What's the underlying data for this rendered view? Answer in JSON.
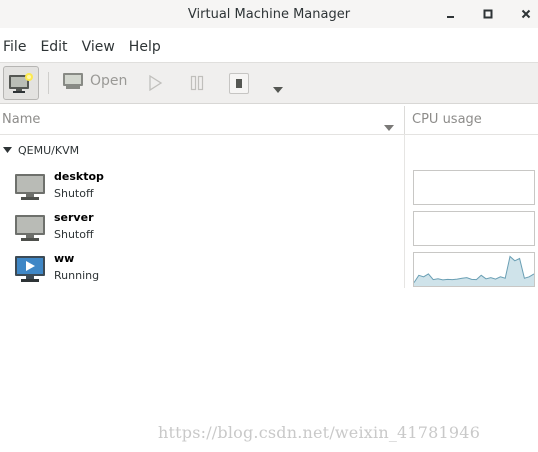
{
  "window": {
    "title": "Virtual Machine Manager"
  },
  "menu": [
    "File",
    "Edit",
    "View",
    "Help"
  ],
  "toolbar": {
    "open_label": "Open"
  },
  "columns": {
    "name": "Name",
    "cpu": "CPU usage"
  },
  "group": {
    "label": "QEMU/KVM"
  },
  "vms": [
    {
      "name": "desktop",
      "status": "Shutoff",
      "icon": "monitor-off-icon"
    },
    {
      "name": "server",
      "status": "Shutoff",
      "icon": "monitor-off-icon"
    },
    {
      "name": "ww",
      "status": "Running",
      "icon": "monitor-running-icon",
      "cpu_usage": [
        0.05,
        0.3,
        0.25,
        0.35,
        0.15,
        0.18,
        0.14,
        0.16,
        0.15,
        0.17,
        0.2,
        0.22,
        0.16,
        0.15,
        0.3,
        0.18,
        0.22,
        0.17,
        0.25,
        0.2,
        0.95,
        0.8,
        0.88,
        0.2,
        0.25,
        0.35
      ]
    }
  ],
  "watermark": "https://blog.csdn.net/weixin_41781946",
  "colors": {
    "cpu_line": "#6a9fb4",
    "cpu_fill": "#cfe3ea"
  }
}
